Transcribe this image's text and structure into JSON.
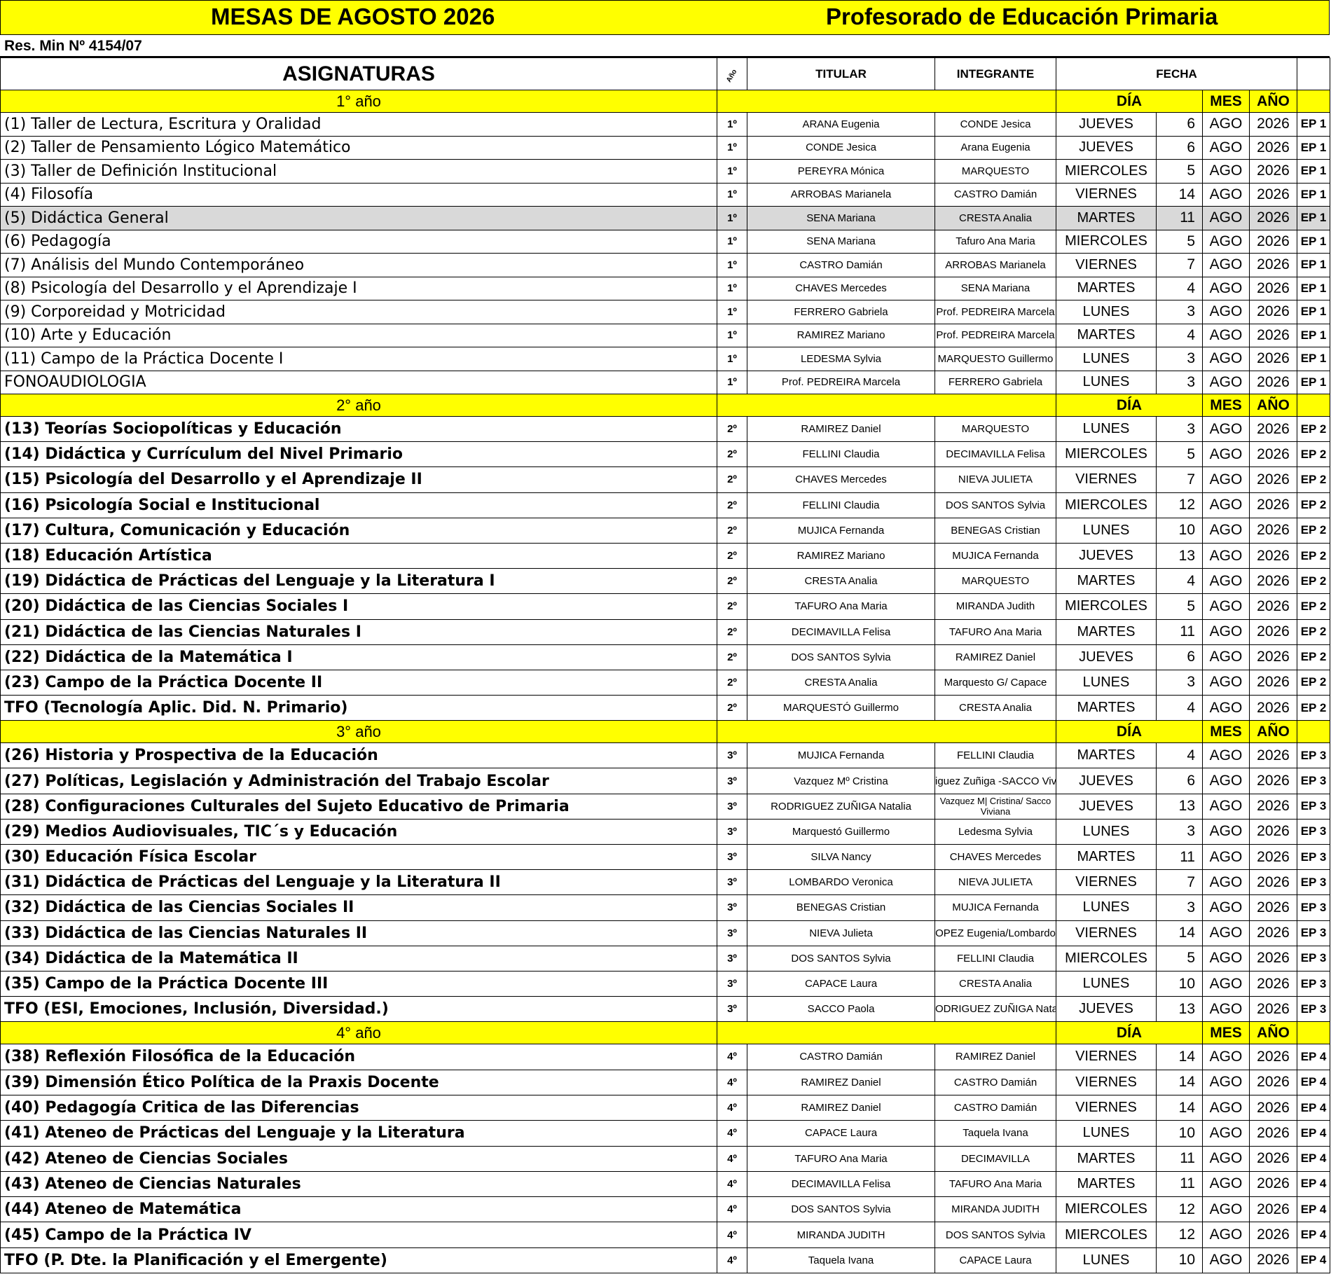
{
  "header": {
    "title_left": "MESAS DE AGOSTO  2026",
    "title_right": "Profesorado de Educación Primaria",
    "resolution": "Res. Min Nº 4154/07"
  },
  "columns": {
    "asignaturas": "ASIGNATURAS",
    "anio": "Año",
    "titular": "TITULAR",
    "integrante": "INTEGRANTE",
    "fecha": "FECHA",
    "dia": "DÍA",
    "mes": "MES",
    "ano": "AÑO"
  },
  "sections": [
    {
      "label": "1° año",
      "rows": [
        {
          "subject": "(1) Taller de Lectura, Escritura y Oralidad",
          "year": "1º",
          "titular": "ARANA Eugenia",
          "integrante": "CONDE Jesica",
          "day": "JUEVES",
          "date": "6",
          "month": "AGO",
          "year_num": "2026",
          "ep": "EP 1"
        },
        {
          "subject": "(2) Taller de Pensamiento Lógico Matemático",
          "year": "1º",
          "titular": "CONDE Jesica",
          "integrante": "Arana  Eugenia",
          "day": "JUEVES",
          "date": "6",
          "month": "AGO",
          "year_num": "2026",
          "ep": "EP 1"
        },
        {
          "subject": "(3) Taller de Definición Institucional",
          "year": "1º",
          "titular": "PEREYRA Mónica",
          "integrante": "MARQUESTO",
          "day": "MIERCOLES",
          "date": "5",
          "month": "AGO",
          "year_num": "2026",
          "ep": "EP 1"
        },
        {
          "subject": "(4) Filosofía",
          "year": "1º",
          "titular": "ARROBAS Marianela",
          "integrante": "CASTRO Damián",
          "day": "VIERNES",
          "date": "14",
          "month": "AGO",
          "year_num": "2026",
          "ep": "EP 1"
        },
        {
          "subject": "(5) Didáctica General",
          "year": "1º",
          "titular": "SENA Mariana",
          "integrante": "CRESTA Analia",
          "day": "MARTES",
          "date": "11",
          "month": "AGO",
          "year_num": "2026",
          "ep": "EP 1",
          "highlight": true
        },
        {
          "subject": "(6) Pedagogía",
          "year": "1º",
          "titular": "SENA Mariana",
          "integrante": "Tafuro Ana Maria",
          "day": "MIERCOLES",
          "date": "5",
          "month": "AGO",
          "year_num": "2026",
          "ep": "EP 1"
        },
        {
          "subject": "(7) Análisis del Mundo Contemporáneo",
          "year": "1º",
          "titular": "CASTRO Damián",
          "integrante": "ARROBAS Marianela",
          "day": "VIERNES",
          "date": "7",
          "month": "AGO",
          "year_num": "2026",
          "ep": "EP 1"
        },
        {
          "subject": "(8) Psicología del Desarrollo y el Aprendizaje I",
          "year": "1º",
          "titular": "CHAVES Mercedes",
          "integrante": "SENA Mariana",
          "day": "MARTES",
          "date": "4",
          "month": "AGO",
          "year_num": "2026",
          "ep": "EP 1"
        },
        {
          "subject": "(9) Corporeidad y Motricidad",
          "year": "1º",
          "titular": "FERRERO Gabriela",
          "integrante": "Prof. PEDREIRA Marcela",
          "day": "LUNES",
          "date": "3",
          "month": "AGO",
          "year_num": "2026",
          "ep": "EP 1"
        },
        {
          "subject": "(10) Arte y Educación",
          "year": "1º",
          "titular": "RAMIREZ Mariano",
          "integrante": "Prof. PEDREIRA Marcela",
          "day": "MARTES",
          "date": "4",
          "month": "AGO",
          "year_num": "2026",
          "ep": "EP 1"
        },
        {
          "subject": "(11) Campo de la Práctica Docente I",
          "year": "1º",
          "titular": "LEDESMA Sylvia",
          "integrante": "MARQUESTO Guillermo",
          "day": "LUNES",
          "date": "3",
          "month": "AGO",
          "year_num": "2026",
          "ep": "EP 1"
        },
        {
          "subject": "FONOAUDIOLOGIA",
          "year": "1º",
          "titular": "Prof. PEDREIRA Marcela",
          "integrante": "FERRERO Gabriela",
          "day": "LUNES",
          "date": "3",
          "month": "AGO",
          "year_num": "2026",
          "ep": "EP 1",
          "dashed": true
        }
      ]
    },
    {
      "label": "2° año",
      "rows": [
        {
          "subject": "(13) Teorías Sociopolíticas y Educación",
          "year": "2º",
          "titular": "RAMIREZ Daniel",
          "integrante": "MARQUESTO",
          "day": "LUNES",
          "date": "3",
          "month": "AGO",
          "year_num": "2026",
          "ep": "EP 2"
        },
        {
          "subject": "(14) Didáctica y Currículum del Nivel Primario",
          "year": "2º",
          "titular": "FELLINI Claudia",
          "integrante": "DECIMAVILLA Felisa",
          "day": "MIERCOLES",
          "date": "5",
          "month": "AGO",
          "year_num": "2026",
          "ep": "EP 2"
        },
        {
          "subject": "(15) Psicología del Desarrollo y el Aprendizaje II",
          "year": "2º",
          "titular": "CHAVES Mercedes",
          "integrante": "NIEVA JULIETA",
          "day": "VIERNES",
          "date": "7",
          "month": "AGO",
          "year_num": "2026",
          "ep": "EP 2"
        },
        {
          "subject": "(16) Psicología Social e Institucional",
          "year": "2º",
          "titular": "FELLINI Claudia",
          "integrante": "DOS SANTOS Sylvia",
          "day": "MIERCOLES",
          "date": "12",
          "month": "AGO",
          "year_num": "2026",
          "ep": "EP 2"
        },
        {
          "subject": "(17) Cultura, Comunicación y Educación",
          "year": "2º",
          "titular": "MUJICA Fernanda",
          "integrante": "BENEGAS Cristian",
          "day": "LUNES",
          "date": "10",
          "month": "AGO",
          "year_num": "2026",
          "ep": "EP 2"
        },
        {
          "subject": "(18) Educación Artística",
          "year": "2º",
          "titular": "RAMIREZ Mariano",
          "integrante": "MUJICA Fernanda",
          "day": "JUEVES",
          "date": "13",
          "month": "AGO",
          "year_num": "2026",
          "ep": "EP 2"
        },
        {
          "subject": "(19) Didáctica de Prácticas del Lenguaje y la Literatura I",
          "year": "2º",
          "titular": "CRESTA Analia",
          "integrante": "MARQUESTO",
          "day": "MARTES",
          "date": "4",
          "month": "AGO",
          "year_num": "2026",
          "ep": "EP 2"
        },
        {
          "subject": "(20) Didáctica de las Ciencias Sociales I",
          "year": "2º",
          "titular": "TAFURO Ana Maria",
          "integrante": "MIRANDA Judith",
          "day": "MIERCOLES",
          "date": "5",
          "month": "AGO",
          "year_num": "2026",
          "ep": "EP 2"
        },
        {
          "subject": "(21) Didáctica de las Ciencias Naturales I",
          "year": "2º",
          "titular": "DECIMAVILLA Felisa",
          "integrante": "TAFURO Ana Maria",
          "day": "MARTES",
          "date": "11",
          "month": "AGO",
          "year_num": "2026",
          "ep": "EP 2"
        },
        {
          "subject": "(22) Didáctica de la Matemática I",
          "year": "2º",
          "titular": "DOS SANTOS Sylvia",
          "integrante": "RAMIREZ Daniel",
          "day": "JUEVES",
          "date": "6",
          "month": "AGO",
          "year_num": "2026",
          "ep": "EP 2"
        },
        {
          "subject": "(23) Campo de la Práctica Docente II",
          "year": "2º",
          "titular": "CRESTA Analia",
          "integrante": "Marquesto G/ Capace",
          "day": "LUNES",
          "date": "3",
          "month": "AGO",
          "year_num": "2026",
          "ep": "EP 2"
        },
        {
          "subject": "TFO (Tecnología Aplic. Did. N. Primario)",
          "year": "2º",
          "titular": "MARQUESTÓ Guillermo",
          "integrante": "CRESTA Analia",
          "day": "MARTES",
          "date": "4",
          "month": "AGO",
          "year_num": "2026",
          "ep": "EP 2",
          "dashed": true
        }
      ]
    },
    {
      "label": "3° año",
      "rows": [
        {
          "subject": "(26) Historia y Prospectiva de la Educación",
          "year": "3º",
          "titular": "MUJICA Fernanda",
          "integrante": "FELLINI Claudia",
          "day": "MARTES",
          "date": "4",
          "month": "AGO",
          "year_num": "2026",
          "ep": "EP 3"
        },
        {
          "subject": "(27) Políticas, Legislación y Administración del Trabajo Escolar",
          "year": "3º",
          "titular": "Vazquez Mº Cristina",
          "integrante": "iguez Zuñiga -SACCO Viv",
          "day": "JUEVES",
          "date": "6",
          "month": "AGO",
          "year_num": "2026",
          "ep": "EP 3"
        },
        {
          "subject": "(28) Configuraciones Culturales del Sujeto Educativo de Primaria",
          "year": "3º",
          "titular": "RODRIGUEZ ZUÑIGA Natalia",
          "integrante": "Vazquez M| Cristina/ Sacco Viviana",
          "day": "JUEVES",
          "date": "13",
          "month": "AGO",
          "year_num": "2026",
          "ep": "EP 3",
          "small": true
        },
        {
          "subject": "(29) Medios Audiovisuales, TIC´s y Educación",
          "year": "3º",
          "titular": "Marquestó Guillermo",
          "integrante": "Ledesma Sylvia",
          "day": "LUNES",
          "date": "3",
          "month": "AGO",
          "year_num": "2026",
          "ep": "EP 3"
        },
        {
          "subject": "(30) Educación Física Escolar",
          "year": "3º",
          "titular": "SILVA Nancy",
          "integrante": "CHAVES Mercedes",
          "day": "MARTES",
          "date": "11",
          "month": "AGO",
          "year_num": "2026",
          "ep": "EP 3"
        },
        {
          "subject": "(31) Didáctica de Prácticas del Lenguaje y la Literatura II",
          "year": "3º",
          "titular": "LOMBARDO  Veronica",
          "integrante": "NIEVA JULIETA",
          "day": "VIERNES",
          "date": "7",
          "month": "AGO",
          "year_num": "2026",
          "ep": "EP 3"
        },
        {
          "subject": "(32) Didáctica de las Ciencias Sociales II",
          "year": "3º",
          "titular": "BENEGAS Cristian",
          "integrante": "MUJICA Fernanda",
          "day": "LUNES",
          "date": "3",
          "month": "AGO",
          "year_num": "2026",
          "ep": "EP 3"
        },
        {
          "subject": "(33) Didáctica de las Ciencias Naturales II",
          "year": "3º",
          "titular": "NIEVA Julieta",
          "integrante": "OPEZ Eugenia/Lombardo",
          "day": "VIERNES",
          "date": "14",
          "month": "AGO",
          "year_num": "2026",
          "ep": "EP 3"
        },
        {
          "subject": "(34) Didáctica de la Matemática II",
          "year": "3º",
          "titular": "DOS SANTOS Sylvia",
          "integrante": "FELLINI Claudia",
          "day": "MIERCOLES",
          "date": "5",
          "month": "AGO",
          "year_num": "2026",
          "ep": "EP 3"
        },
        {
          "subject": "(35) Campo de la Práctica Docente III",
          "year": "3º",
          "titular": "CAPACE Laura",
          "integrante": "CRESTA Analia",
          "day": "LUNES",
          "date": "10",
          "month": "AGO",
          "year_num": "2026",
          "ep": "EP 3"
        },
        {
          "subject": "TFO (ESI, Emociones, Inclusión, Diversidad.)",
          "year": "3º",
          "titular": "SACCO Paola",
          "integrante": "ODRIGUEZ ZUÑIGA Natal",
          "day": "JUEVES",
          "date": "13",
          "month": "AGO",
          "year_num": "2026",
          "ep": "EP 3",
          "dashed": true
        }
      ]
    },
    {
      "label": "4° año",
      "rows": [
        {
          "subject": "(38) Reflexión Filosófica de la Educación",
          "year": "4º",
          "titular": "CASTRO Damián",
          "integrante": "RAMIREZ Daniel",
          "day": "VIERNES",
          "date": "14",
          "month": "AGO",
          "year_num": "2026",
          "ep": "EP 4"
        },
        {
          "subject": "(39) Dimensión Ético Política de la Praxis Docente",
          "year": "4º",
          "titular": "RAMIREZ Daniel",
          "integrante": "CASTRO Damián",
          "day": "VIERNES",
          "date": "14",
          "month": "AGO",
          "year_num": "2026",
          "ep": "EP 4"
        },
        {
          "subject": "(40) Pedagogía Critica de las Diferencias",
          "year": "4º",
          "titular": "RAMIREZ Daniel",
          "integrante": "CASTRO Damián",
          "day": "VIERNES",
          "date": "14",
          "month": "AGO",
          "year_num": "2026",
          "ep": "EP 4"
        },
        {
          "subject": "(41) Ateneo de Prácticas del Lenguaje y la Literatura",
          "year": "4º",
          "titular": "CAPACE Laura",
          "integrante": "Taquela Ivana",
          "day": "LUNES",
          "date": "10",
          "month": "AGO",
          "year_num": "2026",
          "ep": "EP 4"
        },
        {
          "subject": "(42) Ateneo de Ciencias Sociales",
          "year": "4º",
          "titular": "TAFURO Ana Maria",
          "integrante": "DECIMAVILLA",
          "day": "MARTES",
          "date": "11",
          "month": "AGO",
          "year_num": "2026",
          "ep": "EP 4"
        },
        {
          "subject": "(43) Ateneo de Ciencias Naturales",
          "year": "4º",
          "titular": "DECIMAVILLA Felisa",
          "integrante": "TAFURO Ana Maria",
          "day": "MARTES",
          "date": "11",
          "month": "AGO",
          "year_num": "2026",
          "ep": "EP 4"
        },
        {
          "subject": "(44) Ateneo de Matemática",
          "year": "4º",
          "titular": "DOS SANTOS Sylvia",
          "integrante": "MIRANDA JUDITH",
          "day": "MIERCOLES",
          "date": "12",
          "month": "AGO",
          "year_num": "2026",
          "ep": "EP 4"
        },
        {
          "subject": "(45) Campo de la Práctica IV",
          "year": "4º",
          "titular": "MIRANDA JUDITH",
          "integrante": "DOS SANTOS Sylvia",
          "day": "MIERCOLES",
          "date": "12",
          "month": "AGO",
          "year_num": "2026",
          "ep": "EP 4"
        },
        {
          "subject": "TFO (P. Dte. la Planificación y el Emergente)",
          "year": "4º",
          "titular": "Taquela Ivana",
          "integrante": "CAPACE Laura",
          "day": "LUNES",
          "date": "10",
          "month": "AGO",
          "year_num": "2026",
          "ep": "EP 4",
          "dashed": true
        }
      ]
    }
  ]
}
